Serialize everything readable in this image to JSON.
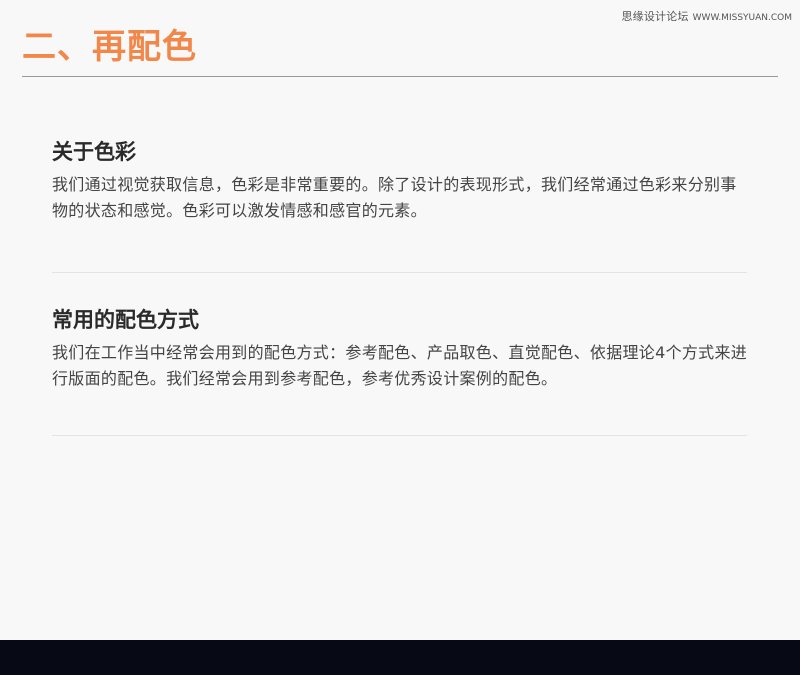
{
  "watermark": {
    "site_name": "思缘设计论坛",
    "url": "WWW.MISSYUAN.COM"
  },
  "page": {
    "title": "二、再配色"
  },
  "sections": [
    {
      "heading": "关于色彩",
      "body": "我们通过视觉获取信息，色彩是非常重要的。除了设计的表现形式，我们经常通过色彩来分别事物的状态和感觉。色彩可以激发情感和感官的元素。"
    },
    {
      "heading": "常用的配色方式",
      "body": "我们在工作当中经常会用到的配色方式：参考配色、产品取色、直觉配色、依据理论4个方式来进行版面的配色。我们经常会用到参考配色，参考优秀设计案例的配色。"
    }
  ],
  "colors": {
    "accent": "#f2874a",
    "background": "#f8f8f8",
    "bottom_bar": "#070a14"
  }
}
